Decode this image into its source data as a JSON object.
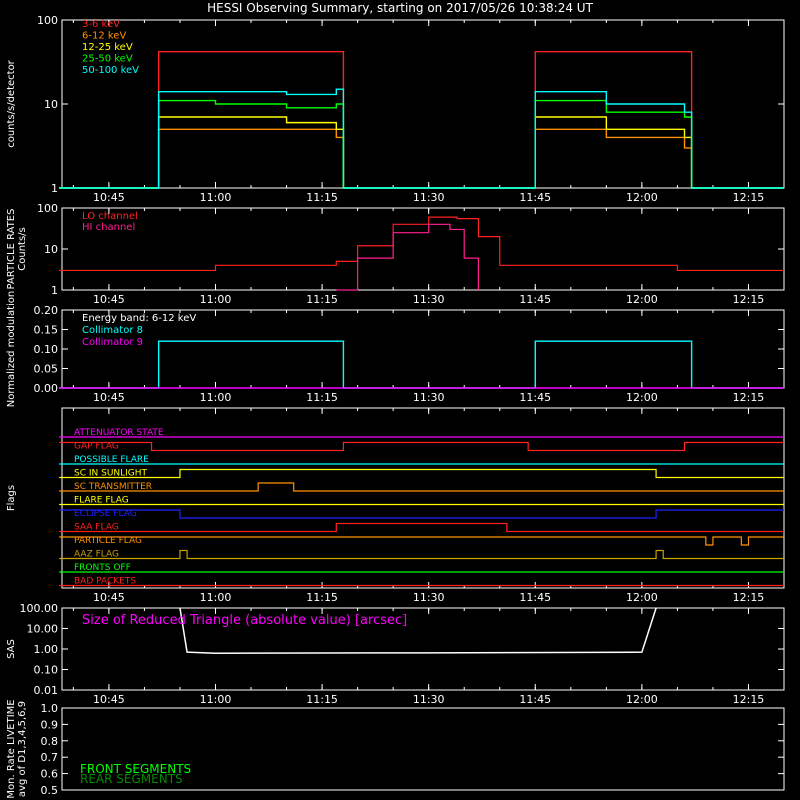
{
  "title": "HESSI Observing Summary, starting on 2017/05/26 10:38:24 UT",
  "time_ticks": [
    "10:45",
    "11:00",
    "11:15",
    "11:30",
    "11:45",
    "12:00",
    "12:15"
  ],
  "chart_data": [
    {
      "type": "line",
      "name": "count-rates",
      "ylabel": "counts/s/detector",
      "y_scale": "log",
      "ylim": [
        1,
        100
      ],
      "ytick_labels": [
        "1",
        "10",
        "100"
      ],
      "series": [
        {
          "name": "3-6 keV",
          "color": "#ff2020",
          "x": [
            "10:38",
            "10:51",
            "10:52",
            "11:17",
            "11:18",
            "11:44",
            "11:45",
            "12:06",
            "12:07",
            "12:20"
          ],
          "values": [
            1,
            1,
            42,
            42,
            1,
            1,
            42,
            42,
            1,
            1
          ]
        },
        {
          "name": "6-12 keV",
          "color": "#ff9000",
          "x": [
            "10:38",
            "10:51",
            "10:52",
            "11:00",
            "11:10",
            "11:17",
            "11:18",
            "11:44",
            "11:45",
            "11:55",
            "12:06",
            "12:07",
            "12:20"
          ],
          "values": [
            1,
            1,
            5,
            5,
            5,
            4,
            1,
            1,
            5,
            4,
            3,
            1,
            1
          ]
        },
        {
          "name": "12-25 keV",
          "color": "#ffff00",
          "x": [
            "10:38",
            "10:51",
            "10:52",
            "11:00",
            "11:10",
            "11:17",
            "11:18",
            "11:44",
            "11:45",
            "11:55",
            "12:06",
            "12:07",
            "12:20"
          ],
          "values": [
            1,
            1,
            7,
            7,
            6,
            5,
            1,
            1,
            7,
            5,
            4,
            1,
            1
          ]
        },
        {
          "name": "25-50 keV",
          "color": "#00ff00",
          "x": [
            "10:38",
            "10:51",
            "10:52",
            "11:00",
            "11:10",
            "11:17",
            "11:18",
            "11:44",
            "11:45",
            "11:55",
            "12:06",
            "12:07",
            "12:20"
          ],
          "values": [
            1,
            1,
            11,
            10,
            9,
            10,
            1,
            1,
            11,
            8,
            7,
            1,
            1
          ]
        },
        {
          "name": "50-100 keV",
          "color": "#00ffff",
          "x": [
            "10:38",
            "10:51",
            "10:52",
            "11:00",
            "11:10",
            "11:17",
            "11:18",
            "11:44",
            "11:45",
            "11:55",
            "12:06",
            "12:07",
            "12:20"
          ],
          "values": [
            1,
            1,
            14,
            14,
            13,
            15,
            1,
            1,
            14,
            10,
            8,
            1,
            1
          ]
        }
      ]
    },
    {
      "type": "line",
      "name": "particle-rates",
      "ylabel": "PARTICLE RATES Counts/s",
      "y_scale": "log",
      "ylim": [
        1,
        100
      ],
      "ytick_labels": [
        "1",
        "10",
        "100"
      ],
      "series": [
        {
          "name": "LO channel",
          "color": "#ff2020",
          "x": [
            "10:38",
            "10:50",
            "11:00",
            "11:10",
            "11:17",
            "11:20",
            "11:25",
            "11:30",
            "11:34",
            "11:37",
            "11:40",
            "11:50",
            "12:05",
            "12:20"
          ],
          "values": [
            3,
            3,
            4,
            4,
            5,
            12,
            40,
            60,
            55,
            20,
            4,
            4,
            3,
            3
          ]
        },
        {
          "name": "HI channel",
          "color": "#ff2090",
          "x": [
            "11:17",
            "11:20",
            "11:25",
            "11:30",
            "11:33",
            "11:35",
            "11:37"
          ],
          "values": [
            1,
            6,
            25,
            40,
            30,
            6,
            1
          ]
        }
      ]
    },
    {
      "type": "line",
      "name": "modulation",
      "ylabel": "Normalized modulation",
      "ylim": [
        0,
        0.2
      ],
      "ytick_labels": [
        "0.00",
        "0.05",
        "0.10",
        "0.15",
        "0.20"
      ],
      "annotation": "Energy band: 6-12 keV",
      "series": [
        {
          "name": "Collimator 8",
          "color": "#00ffff",
          "x": [
            "10:38",
            "10:51",
            "10:52",
            "11:17",
            "11:18",
            "11:44",
            "11:45",
            "12:06",
            "12:07",
            "12:20"
          ],
          "values": [
            0,
            0,
            0.12,
            0.12,
            0,
            0,
            0.12,
            0.12,
            0,
            0
          ]
        },
        {
          "name": "Collimator 9",
          "color": "#ff00ff",
          "x": [
            "10:38",
            "12:20"
          ],
          "values": [
            0,
            0
          ]
        }
      ]
    },
    {
      "type": "line",
      "name": "flags",
      "ylabel": "Flags",
      "series": [
        {
          "name": "ATTENUATOR STATE",
          "color": "#ff00ff",
          "x": [
            "10:38",
            "12:20"
          ],
          "values": [
            0,
            0
          ]
        },
        {
          "name": "GAP FLAG",
          "color": "#ff2020",
          "x": [
            "10:38",
            "10:51",
            "11:18",
            "11:44",
            "12:06",
            "12:20"
          ],
          "values": [
            1,
            0,
            1,
            0,
            1,
            1
          ]
        },
        {
          "name": "POSSIBLE FLARE",
          "color": "#00ffff",
          "x": [
            "10:38",
            "12:20"
          ],
          "values": [
            0,
            0
          ]
        },
        {
          "name": "SC IN SUNLIGHT",
          "color": "#ffff00",
          "x": [
            "10:38",
            "10:55",
            "12:02",
            "12:20"
          ],
          "values": [
            0,
            1,
            0,
            0
          ]
        },
        {
          "name": "SC TRANSMITTER",
          "color": "#ff9000",
          "x": [
            "10:38",
            "11:06",
            "11:11",
            "12:20"
          ],
          "values": [
            0,
            1,
            0,
            0
          ]
        },
        {
          "name": "FLARE FLAG",
          "color": "#ffff00",
          "x": [
            "10:38",
            "12:20"
          ],
          "values": [
            0,
            0
          ]
        },
        {
          "name": "ECLIPSE FLAG",
          "color": "#2020ff",
          "x": [
            "10:38",
            "10:55",
            "12:02",
            "12:20"
          ],
          "values": [
            1,
            0,
            1,
            1
          ]
        },
        {
          "name": "SAA FLAG",
          "color": "#ff2020",
          "x": [
            "10:38",
            "11:17",
            "11:41",
            "12:20"
          ],
          "values": [
            0,
            1,
            0,
            0
          ]
        },
        {
          "name": "PARTICLE FLAG",
          "color": "#ff9000",
          "x": [
            "10:38",
            "12:09",
            "12:10",
            "12:14",
            "12:15",
            "12:20"
          ],
          "values": [
            1,
            0,
            1,
            0,
            1,
            1
          ]
        },
        {
          "name": "AAZ FLAG",
          "color": "#c8a000",
          "x": [
            "10:38",
            "10:55",
            "10:56",
            "12:02",
            "12:03",
            "12:20"
          ],
          "values": [
            0,
            1,
            0,
            1,
            0,
            0
          ]
        },
        {
          "name": "FRONTS OFF",
          "color": "#00ff00",
          "x": [
            "10:38",
            "12:20"
          ],
          "values": [
            0,
            0
          ]
        },
        {
          "name": "BAD PACKETS",
          "color": "#ff2020",
          "x": [
            "10:38",
            "12:20"
          ],
          "values": [
            0,
            0
          ]
        }
      ]
    },
    {
      "type": "line",
      "name": "sas",
      "ylabel": "SAS",
      "y_scale": "log",
      "ylim": [
        0.01,
        100
      ],
      "ytick_labels": [
        "0.01",
        "0.10",
        "1.00",
        "10.00",
        "100.00"
      ],
      "annotation": "Size of Reduced Triangle (absolute value) [arcsec]",
      "series": [
        {
          "name": "SAS",
          "color": "#ffffff",
          "x": [
            "10:55",
            "10:56",
            "11:00",
            "11:30",
            "12:00",
            "12:02"
          ],
          "values": [
            100,
            0.7,
            0.62,
            0.65,
            0.7,
            100
          ]
        }
      ]
    },
    {
      "type": "line",
      "name": "livetime",
      "ylabel": "Mon. Rate LIVETIME avg of D1,3,4,5,6,9",
      "ylim": [
        0.5,
        1.0
      ],
      "ytick_labels": [
        "0.5",
        "0.6",
        "0.7",
        "0.8",
        "0.9",
        "1.0"
      ],
      "series": [
        {
          "name": "FRONT SEGMENTS",
          "color": "#00ff00",
          "x": [],
          "values": []
        },
        {
          "name": "REAR SEGMENTS",
          "color": "#008a00",
          "x": [],
          "values": []
        }
      ]
    }
  ]
}
